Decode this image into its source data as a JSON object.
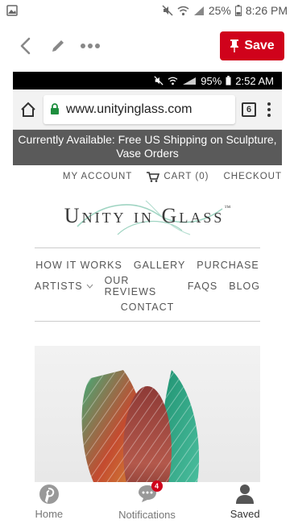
{
  "status_bar": {
    "battery": "25%",
    "time": "8:26 PM"
  },
  "pin_toolbar": {
    "save_label": "Save"
  },
  "pinned_screenshot": {
    "status": {
      "battery": "95%",
      "time": "2:52 AM"
    },
    "browser": {
      "url": "www.unityinglass.com",
      "tab_count": "6"
    },
    "promo_text": "Currently Available: Free US Shipping on Sculpture, Vase Orders",
    "account_links": {
      "my_account": "MY ACCOUNT",
      "cart": "CART (0)",
      "checkout": "CHECKOUT"
    },
    "logo": {
      "text": "Unity in Glass",
      "tm": "™"
    },
    "menu": {
      "row1": [
        "HOW IT WORKS",
        "GALLERY",
        "PURCHASE"
      ],
      "row2": [
        "ARTISTS",
        "OUR REVIEWS",
        "FAQS",
        "BLOG"
      ],
      "row3": [
        "CONTACT"
      ]
    }
  },
  "bottom_nav": {
    "home": "Home",
    "notifications": "Notifications",
    "notifications_count": "4",
    "saved": "Saved"
  },
  "colors": {
    "pinterest_red": "#d0021b",
    "promo_bar": "#5a5a5a",
    "logo_swirl": "#9fd4c2"
  }
}
